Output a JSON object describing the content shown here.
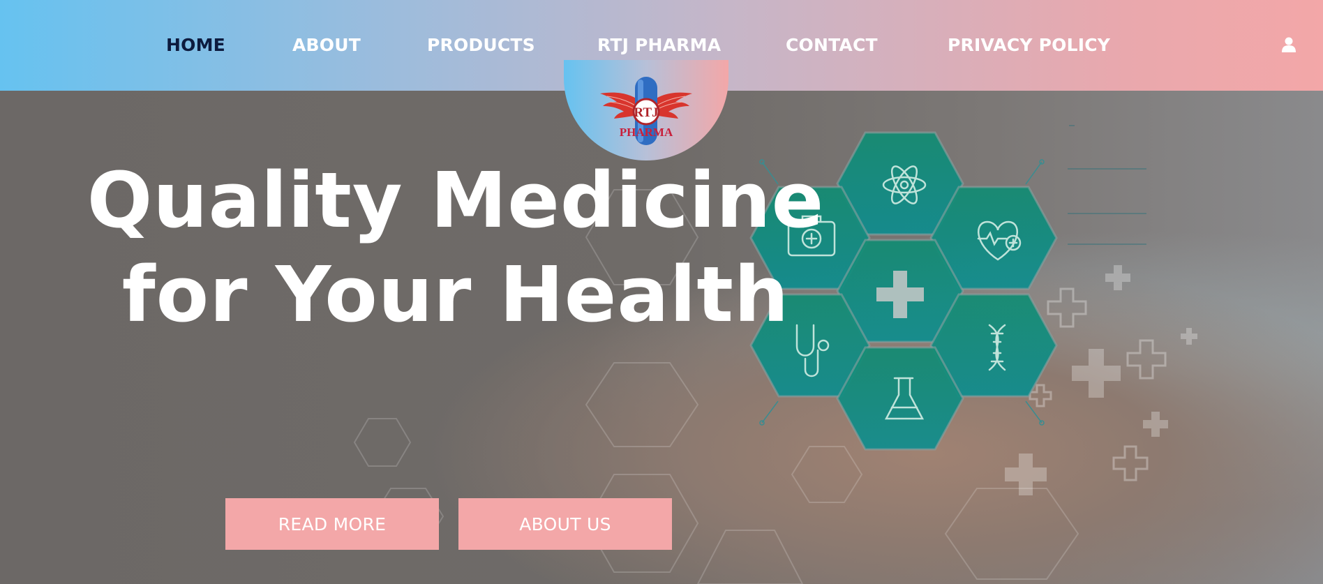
{
  "nav": {
    "items": [
      {
        "label": "HOME",
        "active": true
      },
      {
        "label": "ABOUT"
      },
      {
        "label": "PRODUCTS"
      },
      {
        "label": "RTJ PHARMA"
      },
      {
        "label": "CONTACT"
      },
      {
        "label": "PRIVACY POLICY"
      }
    ],
    "user_icon": "user-icon"
  },
  "logo": {
    "line1": "RTJ",
    "line2": "PHARMA"
  },
  "hero": {
    "headline_line1": "Quality Medicine",
    "headline_line2": "for Your Health",
    "buttons": {
      "read_more": "READ MORE",
      "about_us": "ABOUT US"
    },
    "hex_icons": [
      "first-aid-kit-icon",
      "atom-icon",
      "heart-pulse-icon",
      "medical-cross-icon",
      "stethoscope-icon",
      "dna-icon",
      "flask-icon"
    ]
  },
  "colors": {
    "header_left": "#66c2f0",
    "header_right": "#f3a7a8",
    "button": "#f3a7a8",
    "active_nav": "#0d1b3e",
    "hex_teal": "#0e8a7a"
  }
}
